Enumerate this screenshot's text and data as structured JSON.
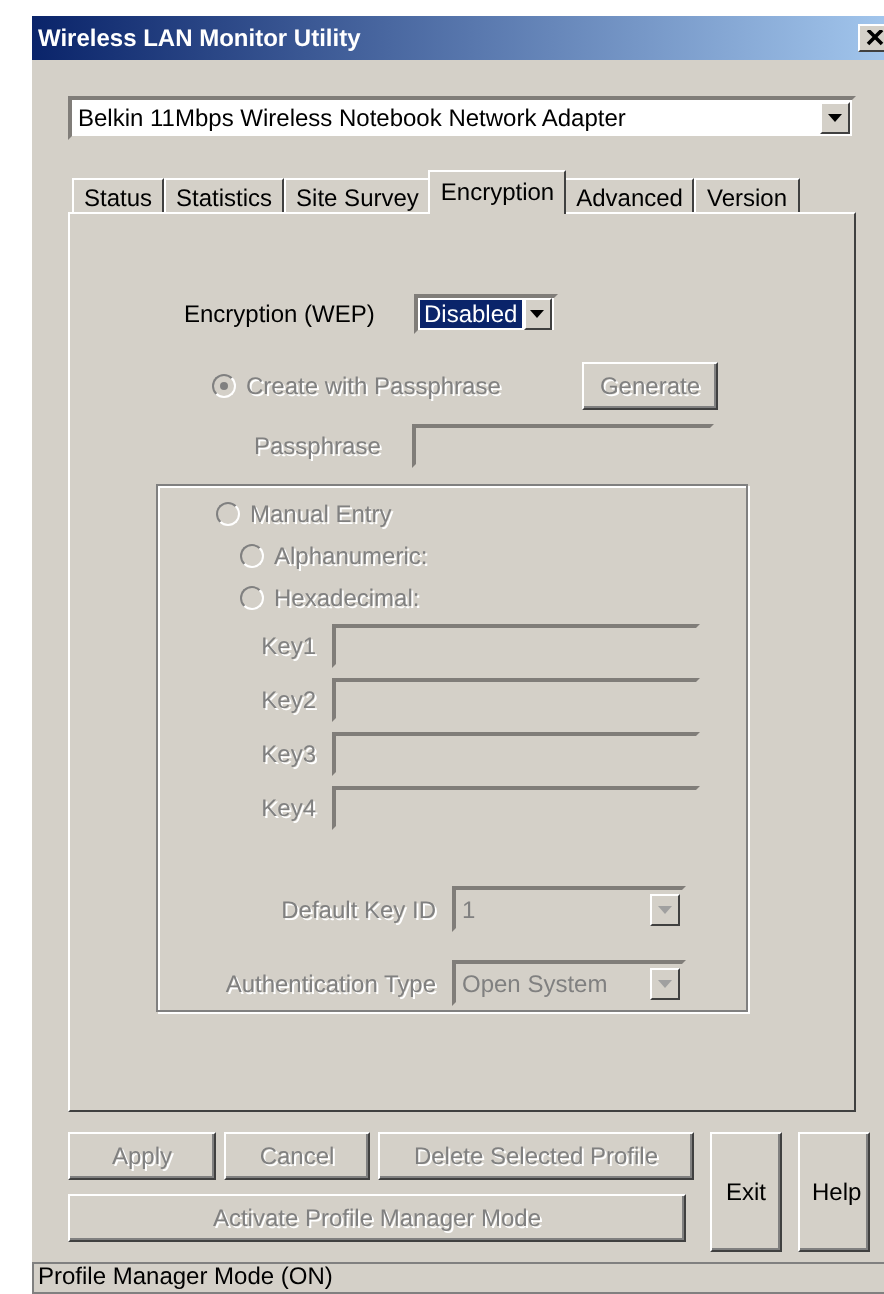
{
  "window": {
    "title": "Wireless LAN Monitor Utility"
  },
  "adapter": {
    "value": "Belkin 11Mbps Wireless Notebook Network Adapter"
  },
  "tabs": [
    {
      "label": "Status",
      "selected": false
    },
    {
      "label": "Statistics",
      "selected": false
    },
    {
      "label": "Site Survey",
      "selected": false
    },
    {
      "label": "Encryption",
      "selected": true
    },
    {
      "label": "Advanced",
      "selected": false
    },
    {
      "label": "Version",
      "selected": false
    }
  ],
  "encryption": {
    "label": "Encryption (WEP)",
    "value": "Disabled"
  },
  "passphrase_radio": {
    "label": "Create with Passphrase",
    "selected": true,
    "disabled": true
  },
  "generate_button": {
    "label": "Generate",
    "disabled": true
  },
  "passphrase": {
    "label": "Passphrase",
    "disabled": true
  },
  "manual_entry": {
    "label": "Manual Entry",
    "selected": false,
    "disabled": true,
    "children": [
      {
        "label": "Alphanumeric:",
        "selected": false,
        "disabled": true
      },
      {
        "label": "Hexadecimal:",
        "selected": false,
        "disabled": true
      }
    ]
  },
  "keys": [
    {
      "label": "Key1",
      "disabled": true
    },
    {
      "label": "Key2",
      "disabled": true
    },
    {
      "label": "Key3",
      "disabled": true
    },
    {
      "label": "Key4",
      "disabled": true
    }
  ],
  "selects": [
    {
      "label": "Default Key ID",
      "value": "1",
      "disabled": true
    },
    {
      "label": "Authentication Type",
      "value": "Open System",
      "disabled": true
    }
  ],
  "buttons_top": [
    {
      "label": "Apply",
      "disabled": true
    },
    {
      "label": "Cancel",
      "disabled": true
    },
    {
      "label": "Delete Selected Profile",
      "disabled": true
    }
  ],
  "buttons_bottom": [
    {
      "label": "Activate Profile Manager Mode",
      "disabled": true
    }
  ],
  "buttons_side": [
    {
      "label": "Exit",
      "disabled": false
    },
    {
      "label": "Help",
      "disabled": false
    }
  ],
  "status_bar": "Profile Manager Mode (ON)"
}
